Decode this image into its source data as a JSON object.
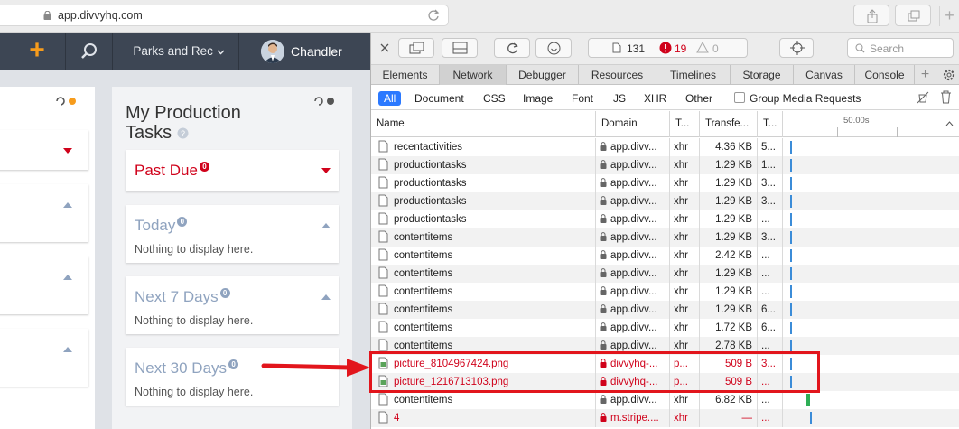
{
  "browser": {
    "url": "app.divvyhq.com"
  },
  "app": {
    "nav": {
      "add_label": "+",
      "org_label": "Parks and Rec",
      "user_name": "Chandler"
    },
    "column_title": "My Production Tasks",
    "cards": [
      {
        "title": "Past Due",
        "count": "0",
        "note": ""
      },
      {
        "title": "Today",
        "count": "0",
        "note": "Nothing to display here."
      },
      {
        "title": "Next 7 Days",
        "count": "0",
        "note": "Nothing to display here."
      },
      {
        "title": "Next 30 Days",
        "count": "0",
        "note": "Nothing to display here."
      }
    ]
  },
  "devtools": {
    "resource_count": "131",
    "error_count": "19",
    "warning_count": "0",
    "search_placeholder": "Search",
    "tabs": [
      "Elements",
      "Network",
      "Debugger",
      "Resources",
      "Timelines",
      "Storage",
      "Canvas",
      "Console"
    ],
    "active_tab": "Network",
    "filters": [
      "All",
      "Document",
      "CSS",
      "Image",
      "Font",
      "JS",
      "XHR",
      "Other"
    ],
    "active_filter": "All",
    "group_media_label": "Group Media Requests",
    "columns": [
      "Name",
      "Domain",
      "T...",
      "Transfe...",
      "T..."
    ],
    "timeline_label": "50.00s",
    "rows": [
      {
        "name": "recentactivities",
        "domain": "app.divv...",
        "type": "xhr",
        "transfer": "4.36 KB",
        "time": "5...",
        "error": false
      },
      {
        "name": "productiontasks",
        "domain": "app.divv...",
        "type": "xhr",
        "transfer": "1.29 KB",
        "time": "1...",
        "error": false
      },
      {
        "name": "productiontasks",
        "domain": "app.divv...",
        "type": "xhr",
        "transfer": "1.29 KB",
        "time": "3...",
        "error": false
      },
      {
        "name": "productiontasks",
        "domain": "app.divv...",
        "type": "xhr",
        "transfer": "1.29 KB",
        "time": "3...",
        "error": false
      },
      {
        "name": "productiontasks",
        "domain": "app.divv...",
        "type": "xhr",
        "transfer": "1.29 KB",
        "time": "...",
        "error": false
      },
      {
        "name": "contentitems",
        "domain": "app.divv...",
        "type": "xhr",
        "transfer": "1.29 KB",
        "time": "3...",
        "error": false
      },
      {
        "name": "contentitems",
        "domain": "app.divv...",
        "type": "xhr",
        "transfer": "2.42 KB",
        "time": "...",
        "error": false
      },
      {
        "name": "contentitems",
        "domain": "app.divv...",
        "type": "xhr",
        "transfer": "1.29 KB",
        "time": "...",
        "error": false
      },
      {
        "name": "contentitems",
        "domain": "app.divv...",
        "type": "xhr",
        "transfer": "1.29 KB",
        "time": "...",
        "error": false
      },
      {
        "name": "contentitems",
        "domain": "app.divv...",
        "type": "xhr",
        "transfer": "1.29 KB",
        "time": "6...",
        "error": false
      },
      {
        "name": "contentitems",
        "domain": "app.divv...",
        "type": "xhr",
        "transfer": "1.72 KB",
        "time": "6...",
        "error": false
      },
      {
        "name": "contentitems",
        "domain": "app.divv...",
        "type": "xhr",
        "transfer": "2.78 KB",
        "time": "...",
        "error": false
      },
      {
        "name": "picture_8104967424.png",
        "domain": "divvyhq-...",
        "type": "p...",
        "transfer": "509 B",
        "time": "3...",
        "error": true
      },
      {
        "name": "picture_1216713103.png",
        "domain": "divvyhq-...",
        "type": "p...",
        "transfer": "509 B",
        "time": "...",
        "error": true
      },
      {
        "name": "contentitems",
        "domain": "app.divv...",
        "type": "xhr",
        "transfer": "6.82 KB",
        "time": "...",
        "error": false
      },
      {
        "name": "4",
        "domain": "m.stripe....",
        "type": "xhr",
        "transfer": "—",
        "time": "...",
        "error": true
      }
    ]
  },
  "colors": {
    "accent_orange": "#f79c1c",
    "nav_bg": "#3d4654",
    "error_red": "#d0021b",
    "highlight_red": "#e2151c",
    "filter_blue": "#2b79ff"
  }
}
